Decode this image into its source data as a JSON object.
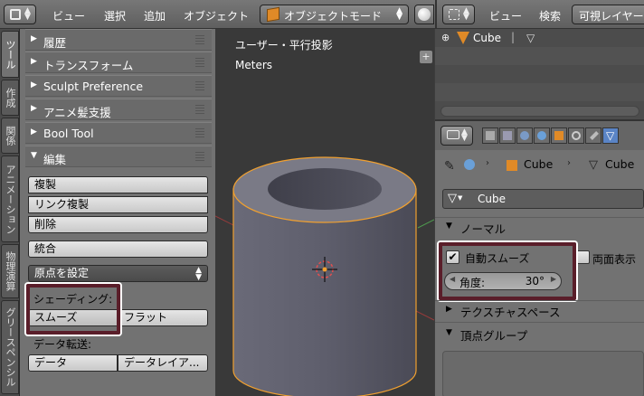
{
  "header_left": {
    "menu": [
      "ビュー",
      "選択",
      "追加",
      "オブジェクト"
    ],
    "mode": "オブジェクトモード"
  },
  "header_right": {
    "menu": [
      "ビュー",
      "検索"
    ],
    "search_filter": "可視レイヤー"
  },
  "vertical_tabs": [
    "ツール",
    "作成",
    "関係",
    "アニメーション",
    "物理演算",
    "グリースペンシル"
  ],
  "shelf": {
    "panels": [
      "履歴",
      "トランスフォーム",
      "Sculpt Preference",
      "アニメ髪支援",
      "Bool Tool"
    ],
    "edit_panel": "編集",
    "edit_buttons": [
      "複製",
      "リンク複製",
      "削除"
    ],
    "join_button": "統合",
    "set_origin": "原点を設定",
    "shading_label": "シェーディング:",
    "smooth_button": "スムーズ",
    "flat_button": "フラット",
    "data_transfer_label": "データ転送:",
    "data_button": "データ",
    "data_layout_button": "データレイア..."
  },
  "viewport": {
    "view_label": "ユーザー・平行投影",
    "units": "Meters"
  },
  "outliner": {
    "object_name": "Cube"
  },
  "properties": {
    "breadcrumb_object": "Cube",
    "breadcrumb_mesh": "Cube",
    "mesh_name": "Cube",
    "normals_panel": "ノーマル",
    "auto_smooth_label": "自動スムーズ",
    "auto_smooth_checked": true,
    "double_sided_label": "両面表示",
    "angle_label": "角度:",
    "angle_value": "30°",
    "texture_space_panel": "テクスチャスペース",
    "vertex_groups_panel": "頂点グループ"
  },
  "colors": {
    "highlight_border": "#5a1e2a",
    "selection_outline": "#f0a030",
    "accent_blue": "#5a84c6",
    "object_orange": "#e08a27"
  }
}
